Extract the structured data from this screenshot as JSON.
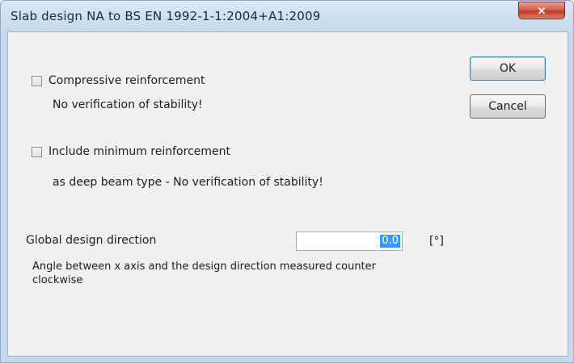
{
  "window": {
    "title": "Slab design NA to BS EN 1992-1-1:2004+A1:2009",
    "close_glyph": "✕"
  },
  "options": {
    "compressive": {
      "label": "Compressive reinforcement",
      "checked": false,
      "note": "No verification of stability!"
    },
    "minimum": {
      "label": "Include minimum reinforcement",
      "checked": false,
      "note": "as deep beam type - No verification of stability!"
    }
  },
  "design_direction": {
    "label": "Global design direction",
    "value": "0.0",
    "unit": "[°]",
    "note": "Angle between x axis and the design direction measured counter clockwise"
  },
  "buttons": {
    "ok": "OK",
    "cancel": "Cancel"
  },
  "colors": {
    "frame": "#c6d8ec",
    "client": "#f0f0f0",
    "close_button": "#c0392b",
    "selection": "#3399ff"
  },
  "icons": {
    "close": "close-icon"
  }
}
